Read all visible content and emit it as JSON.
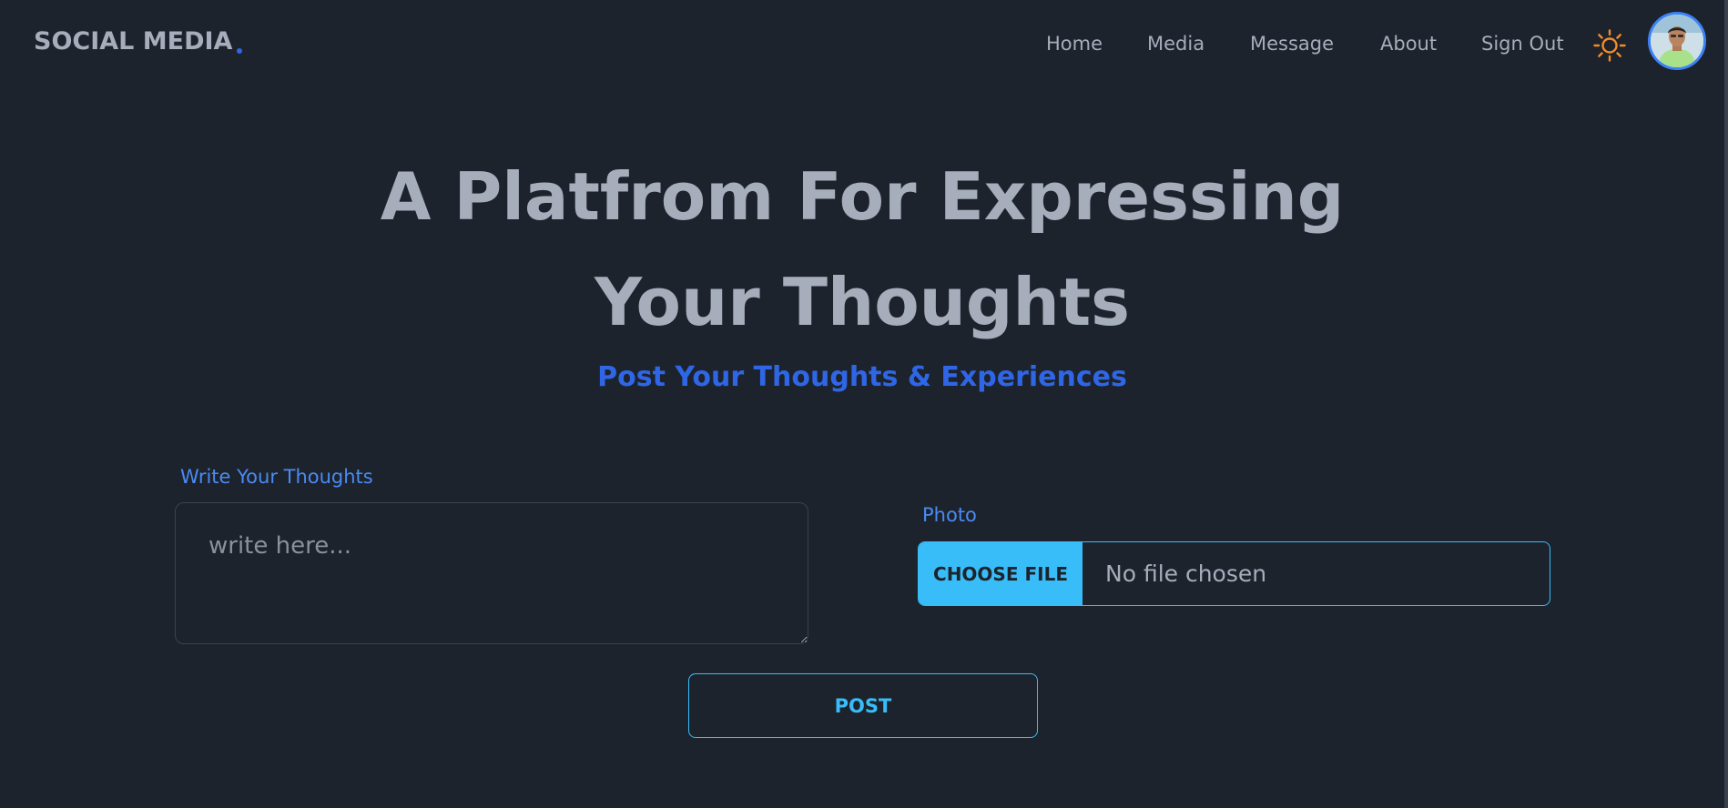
{
  "brand": {
    "name": "SOCIAL MEDIA",
    "accent_color": "#2f66e6"
  },
  "nav": {
    "items": [
      {
        "label": "Home"
      },
      {
        "label": "Media"
      },
      {
        "label": "Message"
      },
      {
        "label": "About"
      },
      {
        "label": "Sign Out"
      }
    ],
    "theme_toggle_icon": "sun-icon",
    "avatar_icon": "user-avatar"
  },
  "hero": {
    "title_line1": "A Platfrom For Expressing",
    "title_line2": "Your Thoughts",
    "subtitle": "Post Your Thoughts & Experiences"
  },
  "form": {
    "thoughts_label": "Write Your Thoughts",
    "thoughts_placeholder": "write here...",
    "thoughts_value": "",
    "photo_label": "Photo",
    "choose_file_label": "CHOOSE FILE",
    "file_status": "No file chosen",
    "post_label": "POST"
  },
  "colors": {
    "background": "#1d232c",
    "text": "#a6adbb",
    "primary": "#2f66e6",
    "label": "#4a8af4",
    "info": "#38bdf8",
    "sun": "#f28c28"
  }
}
